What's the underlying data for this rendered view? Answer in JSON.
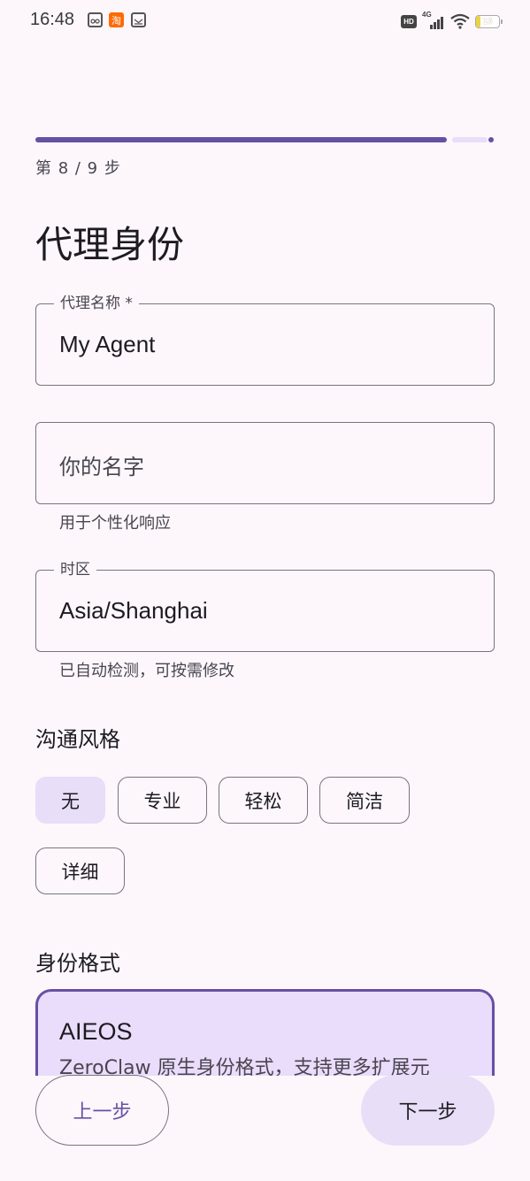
{
  "status_bar": {
    "time": "16:48",
    "hd": "HD",
    "network": "4G",
    "battery_level": "16",
    "battery_fraction": 0.16
  },
  "wizard": {
    "step_label": "第 8 / 9 步",
    "progress_fraction": 0.889,
    "title": "代理身份"
  },
  "fields": {
    "agent_name": {
      "label": "代理名称 *",
      "value": "My Agent"
    },
    "user_name": {
      "placeholder": "你的名字",
      "helper": "用于个性化响应"
    },
    "timezone": {
      "label": "时区",
      "value": "Asia/Shanghai",
      "helper": "已自动检测，可按需修改"
    }
  },
  "communication_style": {
    "title": "沟通风格",
    "options": [
      "无",
      "专业",
      "轻松",
      "简洁",
      "详细"
    ],
    "selected": "无"
  },
  "identity_format": {
    "title": "身份格式",
    "card_title": "AIEOS",
    "card_description": "ZeroClaw 原生身份格式，支持更多扩展元"
  },
  "navigation": {
    "prev_label": "上一步",
    "next_label": "下一步"
  },
  "colors": {
    "primary": "#6750a4",
    "secondary_container": "#e8def8",
    "background": "#fdf7fc"
  }
}
